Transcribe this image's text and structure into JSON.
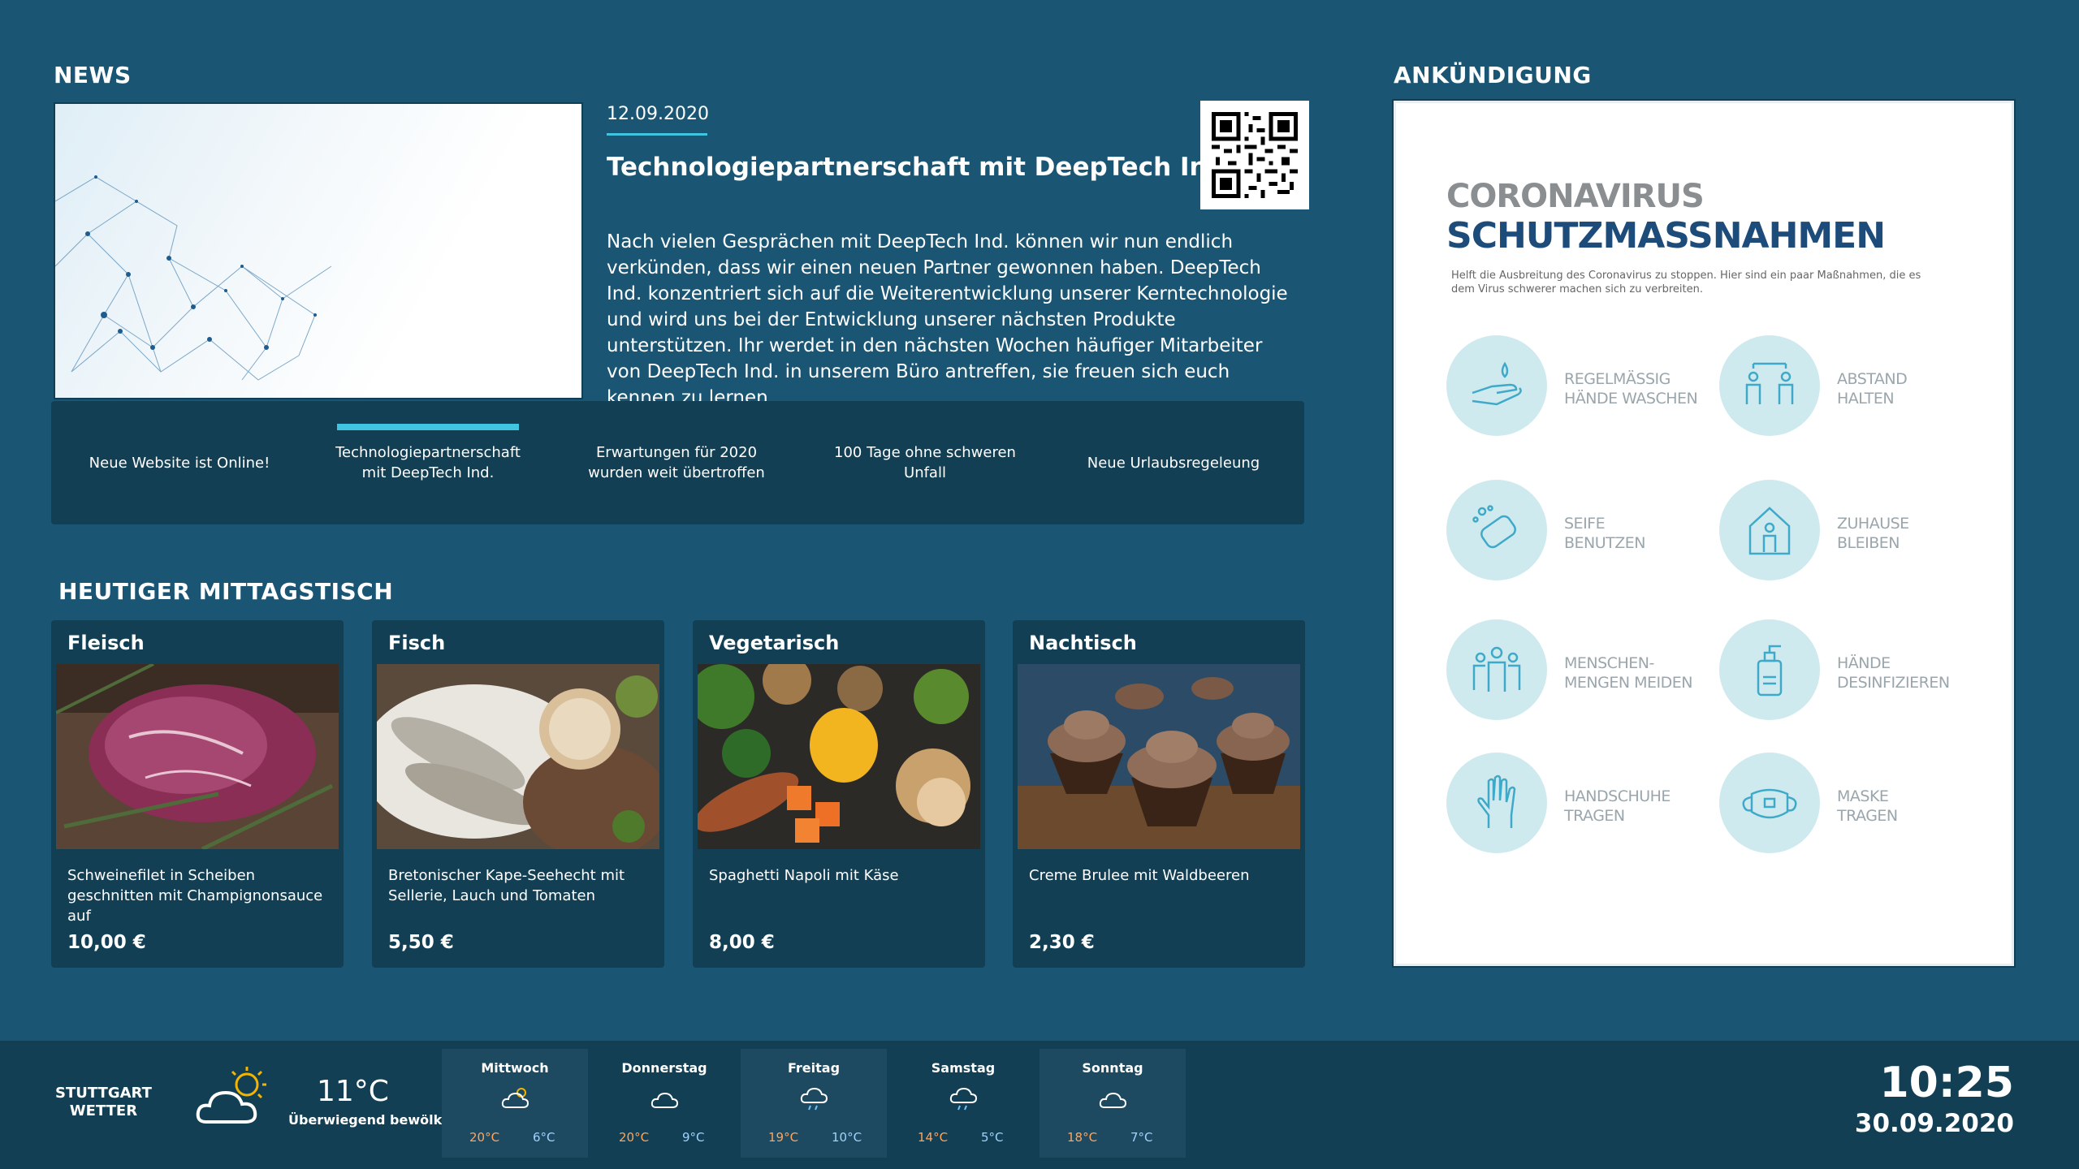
{
  "news": {
    "section_title": "NEWS",
    "date": "12.09.2020",
    "headline": "Technologiepartnerschaft mit DeepTech Ind.",
    "body": "Nach vielen Gesprächen mit DeepTech Ind. können wir nun endlich verkünden, dass wir einen neuen Partner gewonnen haben. DeepTech Ind. konzentriert sich auf die Weiterentwicklung unserer Kerntechnologie und wird uns bei der Entwicklung unserer nächsten Produkte unterstützen. Ihr werdet in den nächsten Wochen häufiger Mitarbeiter von DeepTech Ind. in unserem Büro antreffen, sie freuen sich euch kennen zu lernen.",
    "tabs": [
      {
        "label": "Neue Website ist Online!",
        "active": false
      },
      {
        "label": "Technologiepartnerschaft mit DeepTech Ind.",
        "active": true
      },
      {
        "label": "Erwartungen für 2020 wurden weit übertroffen",
        "active": false
      },
      {
        "label": "100 Tage ohne schweren Unfall",
        "active": false
      },
      {
        "label": "Neue Urlaubsregeleung",
        "active": false
      }
    ]
  },
  "lunch": {
    "section_title": "HEUTIGER MITTAGSTISCH",
    "dishes": [
      {
        "category": "Fleisch",
        "description": "Schweinefilet in Scheiben geschnitten mit Champignonsauce auf",
        "price": "10,00 €"
      },
      {
        "category": "Fisch",
        "description": "Bretonischer Kape-Seehecht mit Sellerie, Lauch und Tomaten",
        "price": "5,50 €"
      },
      {
        "category": "Vegetarisch",
        "description": "Spaghetti Napoli mit Käse",
        "price": "8,00 €"
      },
      {
        "category": "Nachtisch",
        "description": "Creme Brulee mit Waldbeeren",
        "price": "2,30 €"
      }
    ]
  },
  "announcement": {
    "section_title": "ANKÜNDIGUNG",
    "poster": {
      "title_line1": "CORONAVIRUS",
      "title_line2": "SCHUTZMASSNAHMEN",
      "intro": "Helft die Ausbreitung des Coronavirus zu stoppen. Hier sind ein paar Maßnahmen, die es dem Virus schwerer machen sich zu verbreiten.",
      "measures": [
        {
          "label": "REGELMÄSSIG\nHÄNDE WASCHEN",
          "icon": "hand-wash-icon"
        },
        {
          "label": "ABSTAND\nHALTEN",
          "icon": "distance-icon"
        },
        {
          "label": "SEIFE\nBENUTZEN",
          "icon": "soap-icon"
        },
        {
          "label": "ZUHAUSE\nBLEIBEN",
          "icon": "home-icon"
        },
        {
          "label": "MENSCHEN-\nMENGEN MEIDEN",
          "icon": "crowd-icon"
        },
        {
          "label": "HÄNDE\nDESINFIZIEREN",
          "icon": "sanitizer-icon"
        },
        {
          "label": "HANDSCHUHE\nTRAGEN",
          "icon": "glove-icon"
        },
        {
          "label": "MASKE\nTRAGEN",
          "icon": "mask-icon"
        }
      ]
    }
  },
  "weather": {
    "city_line1": "STUTTGART",
    "city_line2": "WETTER",
    "current_temp": "11°C",
    "current_condition": "Überwiegend bewölkt",
    "forecast": [
      {
        "day": "Mittwoch",
        "high": "20°C",
        "low": "6°C",
        "icon": "partly-sunny-icon"
      },
      {
        "day": "Donnerstag",
        "high": "20°C",
        "low": "9°C",
        "icon": "cloud-icon"
      },
      {
        "day": "Freitag",
        "high": "19°C",
        "low": "10°C",
        "icon": "rain-cloud-icon"
      },
      {
        "day": "Samstag",
        "high": "14°C",
        "low": "5°C",
        "icon": "rain-cloud-icon"
      },
      {
        "day": "Sonntag",
        "high": "18°C",
        "low": "7°C",
        "icon": "cloud-icon"
      }
    ]
  },
  "clock": {
    "time": "10:25",
    "date": "30.09.2020"
  },
  "colors": {
    "background": "#1a5673",
    "panel": "#123f53",
    "accent": "#40c4e0"
  }
}
